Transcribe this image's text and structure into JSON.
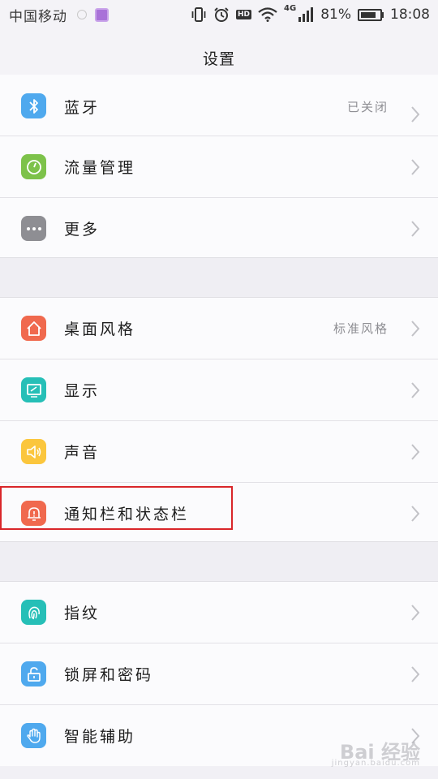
{
  "status_bar": {
    "carrier": "中国移动",
    "hd": "HD",
    "network": "4G",
    "battery_percent": "81%",
    "battery_level": 0.81,
    "time": "18:08"
  },
  "header": {
    "title": "设置"
  },
  "groups": [
    {
      "items": [
        {
          "label": "蓝牙",
          "value": "已关闭",
          "icon": "bluetooth-icon",
          "color": "#4fa9ee"
        },
        {
          "label": "流量管理",
          "value": "",
          "icon": "data-usage-icon",
          "color": "#7dc24a"
        },
        {
          "label": "更多",
          "value": "",
          "icon": "more-dots-icon",
          "color": "#8e8e93"
        }
      ]
    },
    {
      "items": [
        {
          "label": "桌面风格",
          "value": "标准风格",
          "icon": "home-icon",
          "color": "#f0694e"
        },
        {
          "label": "显示",
          "value": "",
          "icon": "display-icon",
          "color": "#26bfb7"
        },
        {
          "label": "声音",
          "value": "",
          "icon": "speaker-icon",
          "color": "#fbc63d"
        },
        {
          "label": "通知栏和状态栏",
          "value": "",
          "icon": "notification-bell-icon",
          "color": "#f0694e"
        }
      ]
    },
    {
      "items": [
        {
          "label": "指纹",
          "value": "",
          "icon": "fingerprint-icon",
          "color": "#26bfb7"
        },
        {
          "label": "锁屏和密码",
          "value": "",
          "icon": "unlock-icon",
          "color": "#4fa9ee"
        },
        {
          "label": "智能辅助",
          "value": "",
          "icon": "hand-icon",
          "color": "#4fa9ee"
        }
      ]
    }
  ],
  "watermark": {
    "text": "Bai 经验",
    "sub": "jingyan.baidu.com"
  }
}
